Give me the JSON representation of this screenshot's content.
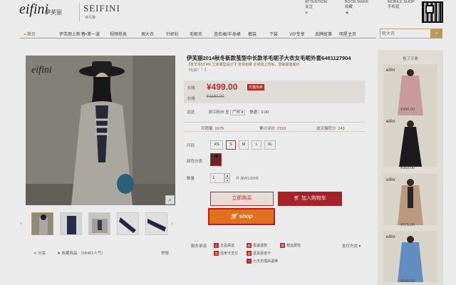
{
  "header": {
    "logo_text": "eifini",
    "logo_cn": "伊芙丽",
    "sub_logo_text": "SEIFINI",
    "sub_logo_cn": "诗凡黎",
    "links": [
      {
        "label": "ATTENTION",
        "sub": "关注",
        "icon": "heart-icon"
      },
      {
        "label": "BOOK MARK",
        "sub": "收藏",
        "icon": "star-icon"
      },
      {
        "label": "MOBILE SHOP",
        "sub": "手机逛",
        "icon": "qr-code-icon"
      }
    ]
  },
  "nav": {
    "items": [
      "首页",
      "伊芙丽上新",
      "春•第一波",
      "视频热卖",
      "周大衣",
      "针织衫",
      "毛呢衣",
      "连衣裙/半身裙",
      "裤装",
      "下装",
      "VIP专享",
      "品牌故事",
      "明星主页"
    ],
    "active_index": 0
  },
  "search": {
    "placeholder": "呢大衣",
    "button_icon": "search-icon"
  },
  "gallery": {
    "main_image": "woman-in-grey-coat-and-hat",
    "logo_overlay": "eifini",
    "zoom_icon": "magnifier-icon",
    "thumbnails": [
      "grey-coat-front",
      "navy-coat",
      "grey-coat-detail",
      "navy-sleeve",
      "navy-sleeve-2"
    ],
    "selected_thumb": 0,
    "share_label": "分享",
    "fav_label": "收藏商品 （6B462人气）",
    "report_label": "举报"
  },
  "product": {
    "title": "伊芙丽2014秋冬新款茧型中长款羊毛呢子大衣女毛呢外套6481127904",
    "subtitle": "【含羊毛51.4% 立体版型设计 】全场包邮 全线线上时尚，雷破超值底价",
    "tag": "【包邮！！】",
    "price_label": "价格",
    "price": "¥499.00",
    "price_badge": "天猫热卖",
    "orig_label": "价格",
    "orig_price": "¥1180.00",
    "ship_label": "运送",
    "ship_from": "浙江杭州",
    "ship_to_label": "至",
    "ship_to": "广州",
    "ship_fee": "快递：0.00",
    "stats": [
      {
        "label": "月销量",
        "value": "1679",
        "green": false
      },
      {
        "label": "累计评价",
        "value": "2153",
        "green": false
      },
      {
        "label": "送天猫积分",
        "value": "249",
        "green": true
      }
    ],
    "size_label": "尺码",
    "sizes": [
      "XS",
      "S",
      "M",
      "L",
      "XL"
    ],
    "selected_size": 1,
    "color_label": "颜色分类",
    "color": "burgundy-coat",
    "qty_label": "数量",
    "qty": "1",
    "qty_up": "▲",
    "qty_down": "▼",
    "stock": "件   库存1360件",
    "buy_label": "立即购买",
    "cart_label": "加入购物车",
    "shop_label": "shop",
    "services_label": "服务承诺",
    "services": [
      {
        "icon": "正",
        "label": "正品保证"
      },
      {
        "icon": "极",
        "label": "极速退款"
      },
      {
        "icon": "赠",
        "label": "赠运费险"
      },
      {
        "icon": "信",
        "label": "信用卡支付"
      },
      {
        "icon": "退",
        "label": "退货承诺卡"
      },
      {
        "icon": "7",
        "label": "七天无理由退换"
      }
    ],
    "payment_label": "支付方式"
  },
  "sidebar": {
    "title": "看了又看",
    "items": [
      {
        "image": "pink-coat",
        "price": "¥499.00"
      },
      {
        "image": "black-dress",
        "price": "¥359.00"
      },
      {
        "image": "beige-coat",
        "price": "¥575.00"
      },
      {
        "image": "blue-coat",
        "price": "¥649.00"
      }
    ]
  }
}
